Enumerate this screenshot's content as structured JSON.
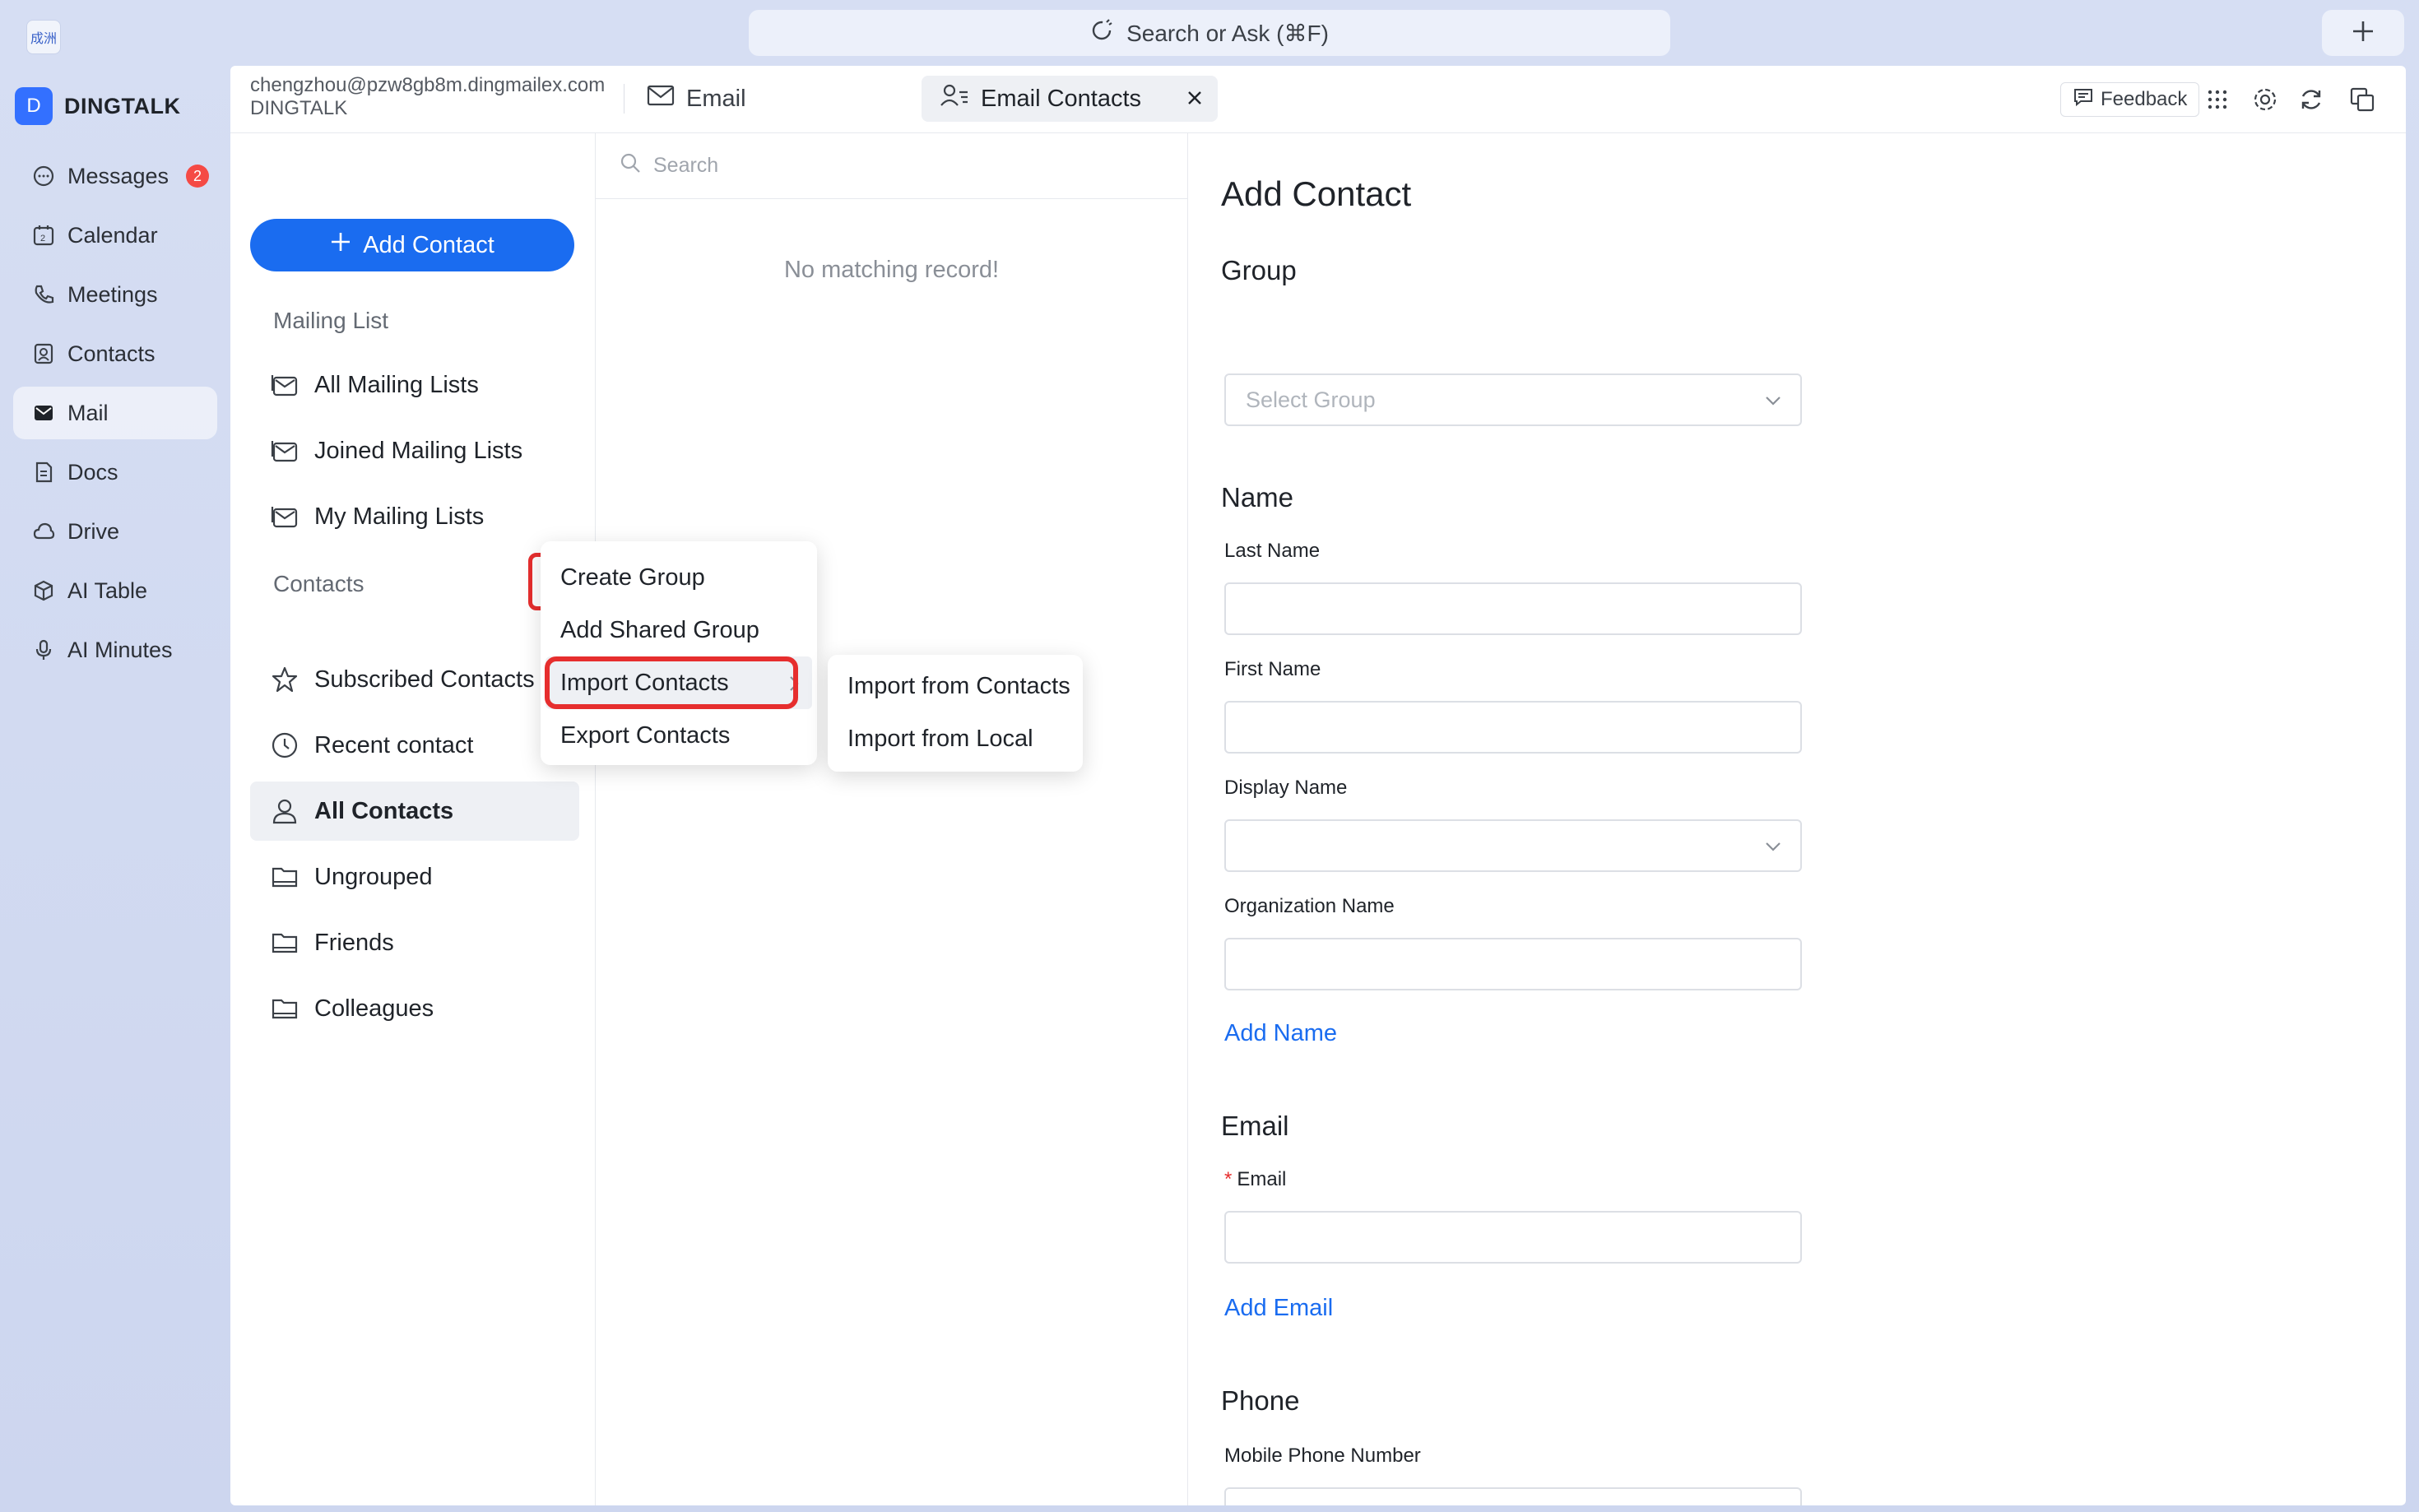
{
  "topbar": {
    "app_logo_text": "成洲",
    "search_label": "Search or Ask (⌘F)"
  },
  "brand": {
    "avatar_letter": "D",
    "name": "DINGTALK"
  },
  "nav": {
    "items": [
      {
        "label": "Messages",
        "badge": "2",
        "icon": "chat-bubble-icon"
      },
      {
        "label": "Calendar",
        "icon": "calendar-icon"
      },
      {
        "label": "Meetings",
        "icon": "phone-icon"
      },
      {
        "label": "Contacts",
        "icon": "contact-card-icon"
      },
      {
        "label": "Mail",
        "icon": "mail-icon",
        "active": true
      },
      {
        "label": "Docs",
        "icon": "document-icon"
      },
      {
        "label": "Drive",
        "icon": "cloud-icon"
      },
      {
        "label": "AI Table",
        "icon": "cube-icon"
      },
      {
        "label": "AI Minutes",
        "icon": "microphone-icon"
      }
    ]
  },
  "header": {
    "account_email": "chengzhou@pzw8gb8m.dingmailex.com",
    "account_org": "DINGTALK",
    "tab_email": "Email",
    "tab_contacts": "Email Contacts",
    "feedback": "Feedback"
  },
  "left_panel": {
    "add_contact_button": "Add Contact",
    "mailing_list_label": "Mailing List",
    "mailing_lists": [
      "All Mailing Lists",
      "Joined Mailing Lists",
      "My Mailing Lists"
    ],
    "contacts_label": "Contacts",
    "more_button": "···",
    "contacts_items": [
      {
        "label": "Subscribed Contacts",
        "icon": "star-icon"
      },
      {
        "label": "Recent contact",
        "icon": "clock-icon"
      },
      {
        "label": "All Contacts",
        "icon": "person-icon",
        "selected": true
      },
      {
        "label": "Ungrouped",
        "icon": "folder-icon"
      },
      {
        "label": "Friends",
        "icon": "folder-icon"
      },
      {
        "label": "Colleagues",
        "icon": "folder-icon"
      }
    ]
  },
  "middle_panel": {
    "search_placeholder": "Search",
    "empty_message": "No matching record!"
  },
  "context_menu": {
    "items": [
      "Create Group",
      "Add Shared Group",
      "Import Contacts",
      "Export Contacts"
    ],
    "submenu": [
      "Import from Contacts",
      "Import from Local"
    ]
  },
  "form": {
    "title": "Add Contact",
    "group_section": "Group",
    "group_placeholder": "Select Group",
    "name_section": "Name",
    "last_name_label": "Last Name",
    "first_name_label": "First Name",
    "display_name_label": "Display Name",
    "org_name_label": "Organization Name",
    "add_name_link": "Add Name",
    "email_section": "Email",
    "email_required_mark": "*",
    "email_label": "Email",
    "add_email_link": "Add Email",
    "phone_section": "Phone",
    "mobile_label": "Mobile Phone Number"
  },
  "colors": {
    "accent": "#1a6cf0",
    "highlight": "#e62e2e",
    "badge": "#f54a45"
  }
}
